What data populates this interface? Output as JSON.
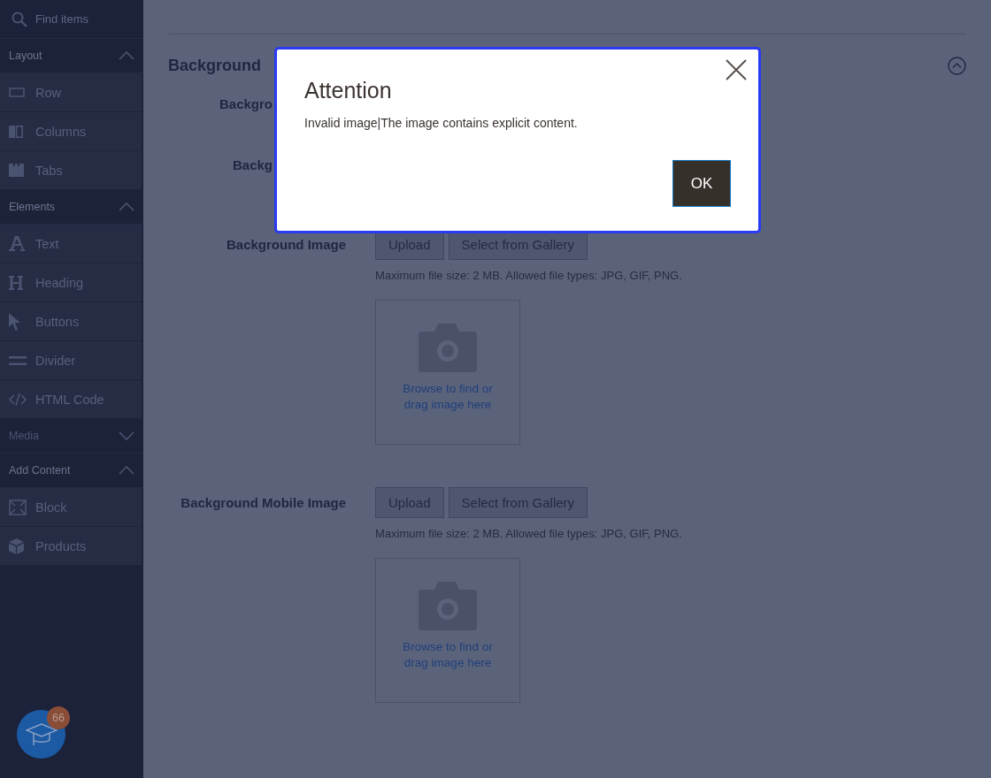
{
  "sidebar": {
    "search": {
      "placeholder": "Find items"
    },
    "groups": [
      {
        "label": "Layout",
        "expanded": true,
        "items": [
          {
            "label": "Row",
            "kind": "row"
          },
          {
            "label": "Columns",
            "kind": "columns"
          },
          {
            "label": "Tabs",
            "kind": "tabs"
          }
        ]
      },
      {
        "label": "Elements",
        "expanded": true,
        "items": [
          {
            "label": "Text",
            "kind": "text"
          },
          {
            "label": "Heading",
            "kind": "heading"
          },
          {
            "label": "Buttons",
            "kind": "pointer"
          },
          {
            "label": "Divider",
            "kind": "divider"
          },
          {
            "label": "HTML Code",
            "kind": "code"
          }
        ]
      },
      {
        "label": "Media",
        "expanded": false
      },
      {
        "label": "Add Content",
        "expanded": true,
        "items": [
          {
            "label": "Block",
            "kind": "block"
          },
          {
            "label": "Products",
            "kind": "box"
          }
        ]
      }
    ],
    "help_badge": "66"
  },
  "section": {
    "title": "Background",
    "expanded": true,
    "rows": [
      {
        "kind": "covered",
        "label": "Backgro"
      },
      {
        "kind": "covered",
        "label": "Backg"
      },
      {
        "kind": "image",
        "label": "Background Image",
        "buttons": [
          "Upload",
          "Select from Gallery"
        ],
        "note": "Maximum file size: 2 MB. Allowed file types: JPG, GIF, PNG.",
        "drop_text": "Browse to find or drag image here"
      },
      {
        "kind": "image",
        "label": "Background Mobile Image",
        "buttons": [
          "Upload",
          "Select from Gallery"
        ],
        "note": "Maximum file size: 2 MB. Allowed file types: JPG, GIF, PNG.",
        "drop_text": "Browse to find or drag image here"
      }
    ]
  },
  "dialog": {
    "title": "Attention",
    "message": "Invalid image|The image contains explicit content.",
    "button": "OK"
  }
}
